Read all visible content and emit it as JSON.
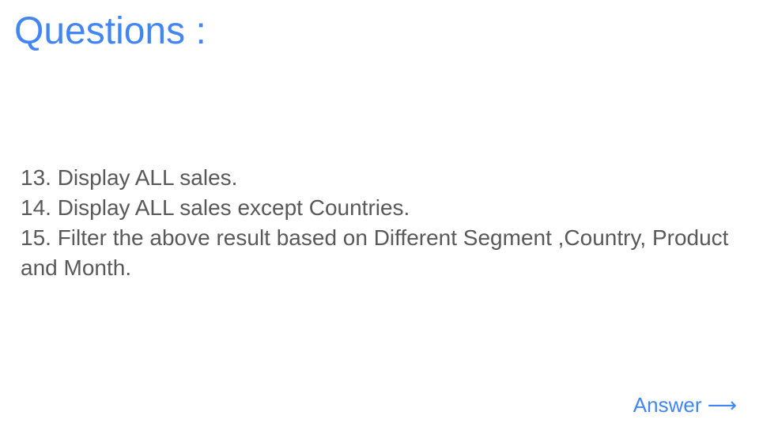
{
  "slide": {
    "title": "Questions :",
    "questions": [
      "13. Display ALL sales.",
      "14. Display ALL sales except Countries.",
      "15. Filter the above result based on Different Segment ,Country, Product and Month."
    ],
    "answer_link": "Answer ⟶"
  },
  "colors": {
    "accent": "#4285f4",
    "body_text": "#595959",
    "background": "#ffffff"
  }
}
